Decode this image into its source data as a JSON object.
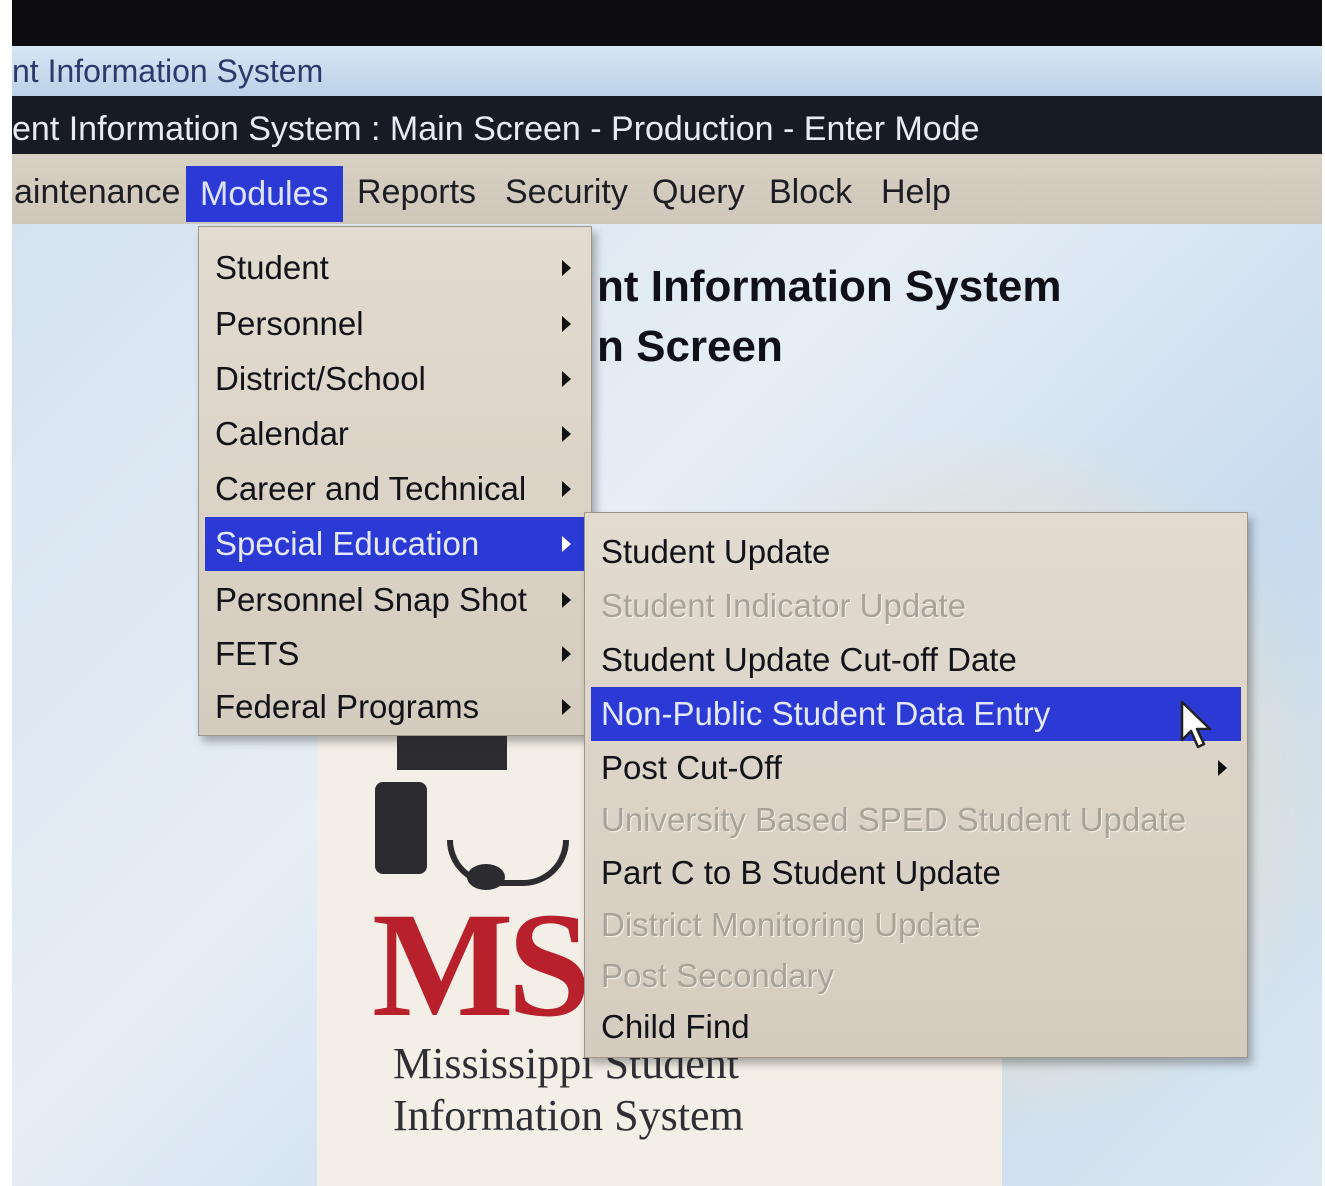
{
  "window": {
    "title": "nt Information System"
  },
  "app": {
    "title": "ent Information System : Main Screen  -  Production  -  Enter Mode"
  },
  "menubar": {
    "items": [
      {
        "label": "aintenance",
        "mnemonic": ""
      },
      {
        "label": "Modules",
        "mnemonic": "o"
      },
      {
        "label": "Reports",
        "mnemonic": "R"
      },
      {
        "label": "Security",
        "mnemonic": "S"
      },
      {
        "label": "Query",
        "mnemonic": "Q"
      },
      {
        "label": "Block",
        "mnemonic": "B"
      },
      {
        "label": "Help",
        "mnemonic": "H"
      }
    ],
    "selected": "Modules"
  },
  "main": {
    "heading_line1": "nt Information System",
    "heading_line2": "n Screen"
  },
  "logo": {
    "mark": "MS",
    "line1": "Mississippi Student",
    "line2": "Information System"
  },
  "modules_menu": {
    "items": [
      {
        "label": "Student",
        "has_submenu": true,
        "state": "enabled"
      },
      {
        "label": "Personnel",
        "has_submenu": true,
        "state": "enabled"
      },
      {
        "label": "District/School",
        "has_submenu": true,
        "state": "enabled"
      },
      {
        "label": "Calendar",
        "has_submenu": true,
        "state": "enabled"
      },
      {
        "label": "Career and Technical",
        "has_submenu": true,
        "state": "enabled"
      },
      {
        "label": "Special Education",
        "has_submenu": true,
        "state": "selected"
      },
      {
        "label": "Personnel Snap Shot",
        "has_submenu": true,
        "state": "enabled"
      },
      {
        "label": "FETS",
        "has_submenu": true,
        "state": "enabled"
      },
      {
        "label": "Federal Programs",
        "has_submenu": true,
        "state": "enabled"
      }
    ]
  },
  "special_education_menu": {
    "items": [
      {
        "label": "Student Update",
        "has_submenu": false,
        "state": "enabled"
      },
      {
        "label": "Student Indicator Update",
        "has_submenu": false,
        "state": "disabled"
      },
      {
        "label": "Student Update Cut-off Date",
        "has_submenu": false,
        "state": "enabled"
      },
      {
        "label": "Non-Public Student Data Entry",
        "has_submenu": false,
        "state": "selected"
      },
      {
        "label": "Post Cut-Off",
        "has_submenu": true,
        "state": "enabled"
      },
      {
        "label": "University Based SPED Student Update",
        "has_submenu": false,
        "state": "disabled"
      },
      {
        "label": "Part C to B Student Update",
        "has_submenu": false,
        "state": "enabled"
      },
      {
        "label": "District Monitoring Update",
        "has_submenu": false,
        "state": "disabled"
      },
      {
        "label": "Post Secondary",
        "has_submenu": false,
        "state": "disabled"
      },
      {
        "label": "Child Find",
        "has_submenu": false,
        "state": "enabled"
      }
    ]
  },
  "colors": {
    "highlight": "#2b3ad4",
    "menu_background": "#d8d0c4",
    "title_bar": "#161b25",
    "logo_red": "#b8202c"
  },
  "icons": {
    "cursor": "mouse-pointer-icon",
    "submenu_arrow": "caret-right-icon"
  }
}
